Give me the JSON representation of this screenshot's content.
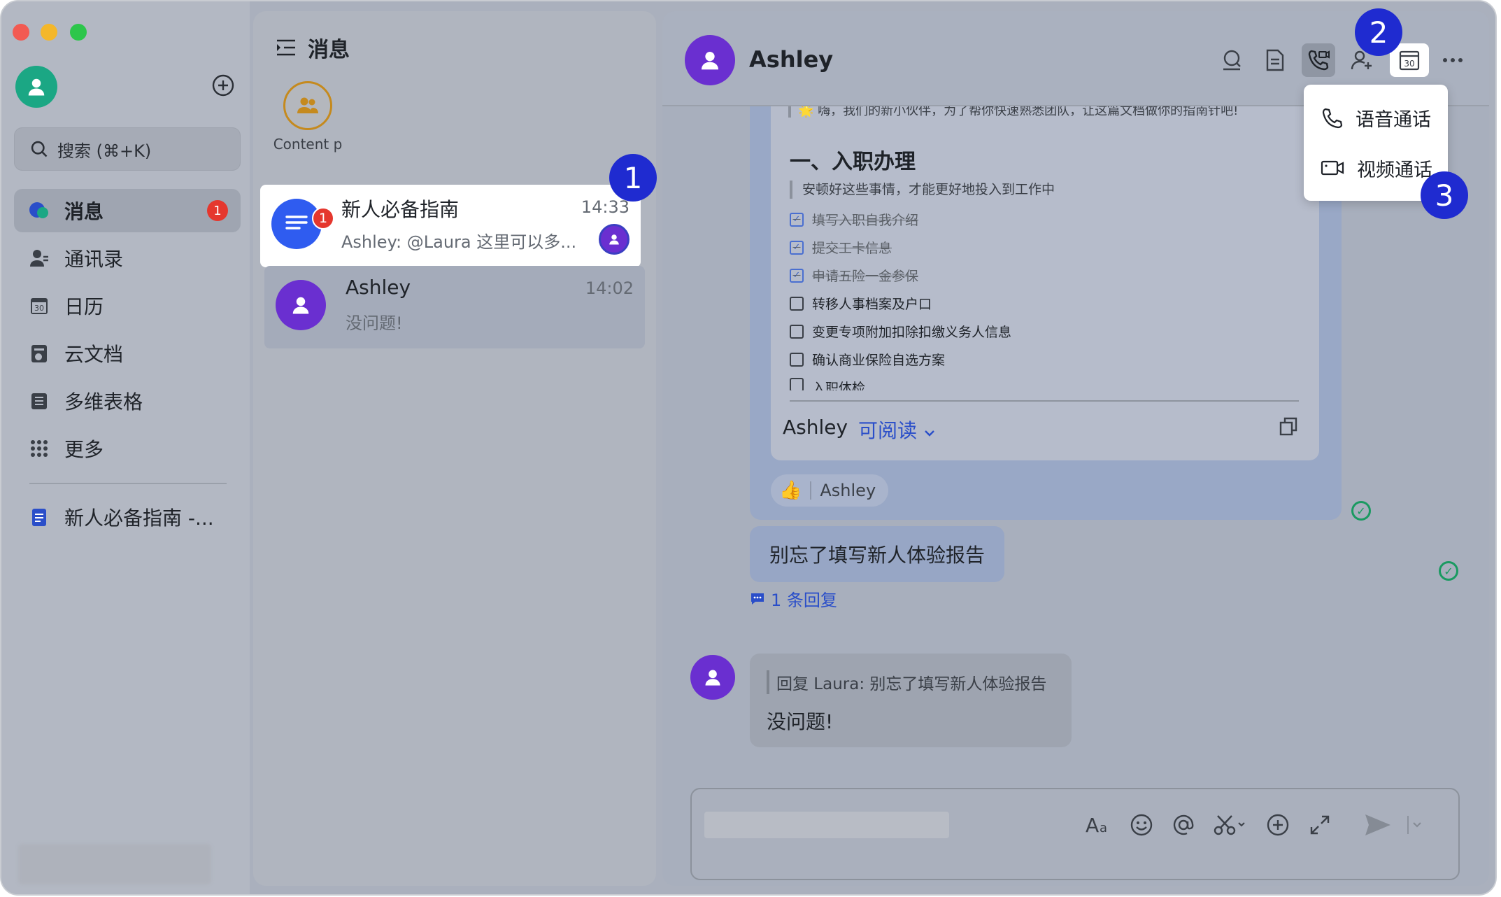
{
  "sidebar": {
    "search_placeholder": "搜索 (⌘+K)",
    "items": [
      {
        "label": "消息",
        "badge": "1"
      },
      {
        "label": "通讯录"
      },
      {
        "label": "日历"
      },
      {
        "label": "云文档"
      },
      {
        "label": "多维表格"
      },
      {
        "label": "更多"
      }
    ],
    "pinned_doc": "新人必备指南 -..."
  },
  "chat_list": {
    "title": "消息",
    "pinned_contact": "Content p",
    "conversations": [
      {
        "name": "新人必备指南",
        "time": "14:33",
        "preview": "Ashley: @Laura 这里可以多...",
        "badge": "1"
      },
      {
        "name": "Ashley",
        "time": "14:02",
        "preview": "没问题!"
      }
    ]
  },
  "chat": {
    "contact_name": "Ashley",
    "doc": {
      "intro": "🌟 嗨，我们的新小伙伴，为了帮你快速熟悉团队，让这篇文档做你的指南针吧!",
      "heading": "一、入职办理",
      "quote": "安顿好这些事情，才能更好地投入到工作中",
      "todos": [
        {
          "text": "填写入职自我介绍",
          "done": true
        },
        {
          "text": "提交工卡信息",
          "done": true
        },
        {
          "text": "申请五险一金参保",
          "done": true
        },
        {
          "text": "转移人事档案及户口",
          "done": false
        },
        {
          "text": "变更专项附加扣除扣缴义务人信息",
          "done": false
        },
        {
          "text": "确认商业保险自选方案",
          "done": false
        },
        {
          "text": "入职体检",
          "done": false
        }
      ],
      "owner": "Ashley",
      "permission": "可阅读"
    },
    "reaction": {
      "emoji": "👍",
      "user": "Ashley"
    },
    "message": "别忘了填写新人体验报告",
    "thread": "1 条回复",
    "reply": {
      "quote": "回复 Laura: 别忘了填写新人体验报告",
      "text": "没问题!"
    },
    "composer_icons": [
      "font-icon",
      "emoji-icon",
      "mention-icon",
      "scissors-icon",
      "add-icon",
      "expand-icon",
      "send-icon"
    ]
  },
  "call_menu": {
    "voice": "语音通话",
    "video": "视频通话"
  },
  "steps": [
    "1",
    "2",
    "3"
  ],
  "colors": {
    "accent_blue": "#2a4ec9",
    "badge_red": "#e5372e",
    "step_marker": "#1f2bd0",
    "avatar_purple": "#6a2fd0",
    "read_green": "#1a9a61"
  }
}
